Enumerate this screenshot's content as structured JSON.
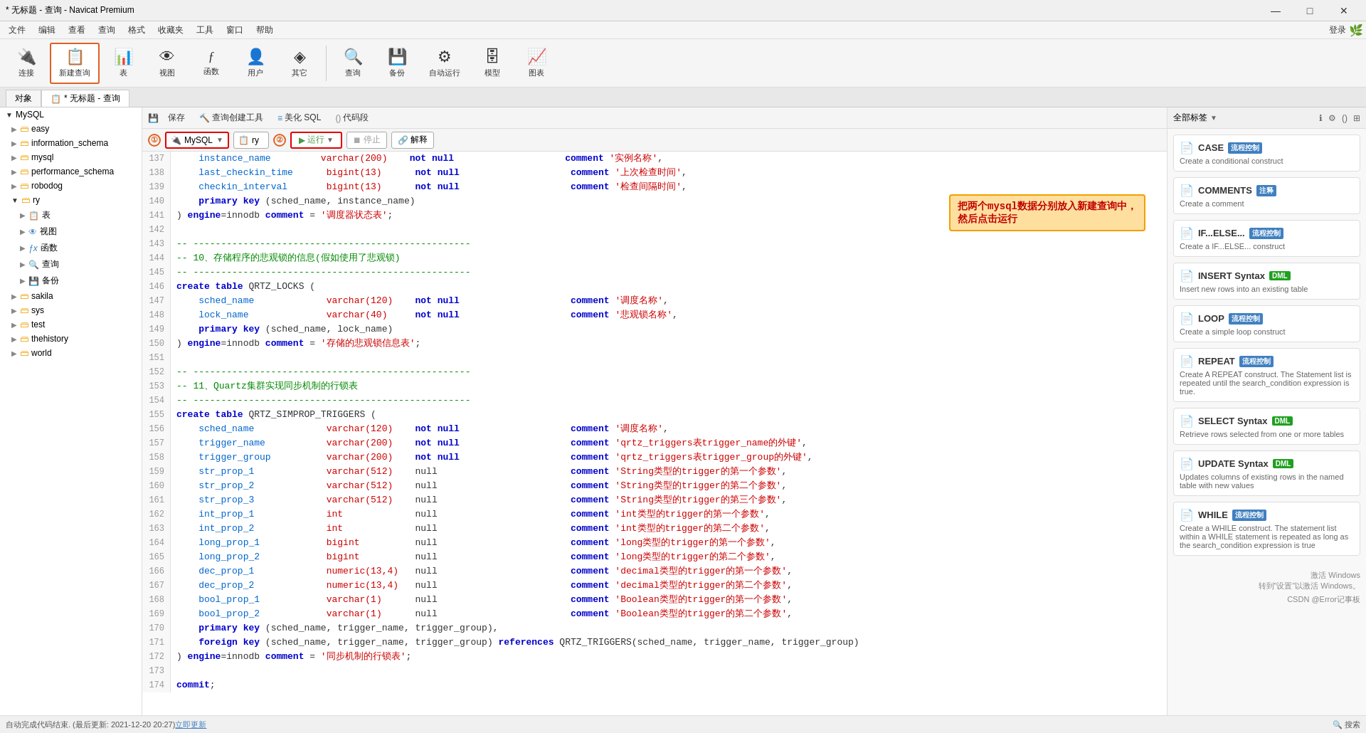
{
  "titlebar": {
    "title": "* 无标题 - 查询 - Navicat Premium",
    "min": "—",
    "max": "□",
    "close": "✕"
  },
  "menubar": {
    "items": [
      "文件",
      "编辑",
      "查看",
      "查询",
      "格式",
      "收藏夹",
      "工具",
      "窗口",
      "帮助"
    ],
    "login": "登录"
  },
  "toolbar": {
    "items": [
      {
        "label": "连接",
        "icon": "🔌"
      },
      {
        "label": "新建查询",
        "icon": "📋",
        "active": true
      },
      {
        "label": "表",
        "icon": "📊"
      },
      {
        "label": "视图",
        "icon": "👁"
      },
      {
        "label": "函数",
        "icon": "ƒ"
      },
      {
        "label": "用户",
        "icon": "👤"
      },
      {
        "label": "其它",
        "icon": "◈"
      },
      {
        "label": "查询",
        "icon": "🔍"
      },
      {
        "label": "备份",
        "icon": "💾"
      },
      {
        "label": "自动运行",
        "icon": "⚙"
      },
      {
        "label": "模型",
        "icon": "🗄"
      },
      {
        "label": "图表",
        "icon": "📈"
      }
    ]
  },
  "tabbar": {
    "object_tab": "对象",
    "query_tab": "* 无标题 - 查询"
  },
  "sidebar": {
    "root": "MySQL",
    "items": [
      {
        "label": "easy",
        "level": 1,
        "type": "db",
        "expanded": false
      },
      {
        "label": "information_schema",
        "level": 1,
        "type": "db"
      },
      {
        "label": "mysql",
        "level": 1,
        "type": "db"
      },
      {
        "label": "performance_schema",
        "level": 1,
        "type": "db"
      },
      {
        "label": "robodog",
        "level": 1,
        "type": "db"
      },
      {
        "label": "ry",
        "level": 1,
        "type": "db",
        "expanded": true
      },
      {
        "label": "表",
        "level": 2,
        "type": "table"
      },
      {
        "label": "视图",
        "level": 2,
        "type": "view"
      },
      {
        "label": "函数",
        "level": 2,
        "type": "fn"
      },
      {
        "label": "查询",
        "level": 2,
        "type": "query"
      },
      {
        "label": "备份",
        "level": 2,
        "type": "backup"
      },
      {
        "label": "sakila",
        "level": 1,
        "type": "db"
      },
      {
        "label": "sys",
        "level": 1,
        "type": "db"
      },
      {
        "label": "test",
        "level": 1,
        "type": "db"
      },
      {
        "label": "thehistory",
        "level": 1,
        "type": "db"
      },
      {
        "label": "world",
        "level": 1,
        "type": "db"
      }
    ]
  },
  "editor_toolbar": {
    "save": "保存",
    "build": "查询创建工具",
    "beautify": "美化 SQL",
    "snippet": "代码段"
  },
  "runbar": {
    "db_placeholder": "MySQL",
    "schema_placeholder": "ry",
    "run": "运行",
    "stop": "停止",
    "explain": "解释",
    "circle1": "①",
    "circle2": "②"
  },
  "code": {
    "lines": [
      {
        "num": 137,
        "content": "    instance_name         varchar(200)    not null                    comment '实例名称',"
      },
      {
        "num": 138,
        "content": "    last_checkin_time      bigint(13)      not null                    comment '上次检查时间',"
      },
      {
        "num": 139,
        "content": "    checkin_interval       bigint(13)      not null                    comment '检查间隔时间',"
      },
      {
        "num": 140,
        "content": "    primary key (sched_name, instance_name)"
      },
      {
        "num": 141,
        "content": ") engine=innodb comment = '调度器状态表';"
      },
      {
        "num": 142,
        "content": ""
      },
      {
        "num": 143,
        "content": "-- --------------------------------------------------"
      },
      {
        "num": 144,
        "content": "-- 10、存储程序的悲观锁的信息(假如使用了悲观锁)"
      },
      {
        "num": 145,
        "content": "-- --------------------------------------------------"
      },
      {
        "num": 146,
        "content": "create table QRTZ_LOCKS ("
      },
      {
        "num": 147,
        "content": "    sched_name             varchar(120)    not null                    comment '调度名称',"
      },
      {
        "num": 148,
        "content": "    lock_name              varchar(40)     not null                    comment '悲观锁名称',"
      },
      {
        "num": 149,
        "content": "    primary key (sched_name, lock_name)"
      },
      {
        "num": 150,
        "content": ") engine=innodb comment = '存储的悲观锁信息表';"
      },
      {
        "num": 151,
        "content": ""
      },
      {
        "num": 152,
        "content": "-- --------------------------------------------------"
      },
      {
        "num": 153,
        "content": "-- 11、Quartz集群实现同步机制的行锁表"
      },
      {
        "num": 154,
        "content": "-- --------------------------------------------------"
      },
      {
        "num": 155,
        "content": "create table QRTZ_SIMPROP_TRIGGERS ("
      },
      {
        "num": 156,
        "content": "    sched_name             varchar(120)    not null                    comment '调度名称',"
      },
      {
        "num": 157,
        "content": "    trigger_name           varchar(200)    not null                    comment 'qrtz_triggers表trigger_name的外键',"
      },
      {
        "num": 158,
        "content": "    trigger_group          varchar(200)    not null                    comment 'qrtz_triggers表trigger_group的外键',"
      },
      {
        "num": 159,
        "content": "    str_prop_1             varchar(512)    null                        comment 'String类型的trigger的第一个参数',"
      },
      {
        "num": 160,
        "content": "    str_prop_2             varchar(512)    null                        comment 'String类型的trigger的第二个参数',"
      },
      {
        "num": 161,
        "content": "    str_prop_3             varchar(512)    null                        comment 'String类型的trigger的第三个参数',"
      },
      {
        "num": 162,
        "content": "    int_prop_1             int             null                        comment 'int类型的trigger的第一个参数',"
      },
      {
        "num": 163,
        "content": "    int_prop_2             int             null                        comment 'int类型的trigger的第二个参数',"
      },
      {
        "num": 164,
        "content": "    long_prop_1            bigint          null                        comment 'long类型的trigger的第一个参数',"
      },
      {
        "num": 165,
        "content": "    long_prop_2            bigint          null                        comment 'long类型的trigger的第二个参数',"
      },
      {
        "num": 166,
        "content": "    dec_prop_1             numeric(13,4)   null                        comment 'decimal类型的trigger的第一个参数',"
      },
      {
        "num": 167,
        "content": "    dec_prop_2             numeric(13,4)   null                        comment 'decimal类型的trigger的第二个参数',"
      },
      {
        "num": 168,
        "content": "    bool_prop_1            varchar(1)      null                        comment 'Boolean类型的trigger的第一个参数',"
      },
      {
        "num": 169,
        "content": "    bool_prop_2            varchar(1)      null                        comment 'Boolean类型的trigger的第二个参数',"
      },
      {
        "num": 170,
        "content": "    primary key (sched_name, trigger_name, trigger_group),"
      },
      {
        "num": 171,
        "content": "    foreign key (sched_name, trigger_name, trigger_group) references QRTZ_TRIGGERS(sched_name, trigger_name, trigger_group)"
      },
      {
        "num": 172,
        "content": ") engine=innodb comment = '同步机制的行锁表';"
      },
      {
        "num": 173,
        "content": ""
      },
      {
        "num": 174,
        "content": "commit;"
      }
    ]
  },
  "annotation": {
    "text": "把两个mysql数据分别放入新建查询中，\n然后点击运行"
  },
  "right_panel": {
    "header": "全部标签",
    "snippets": [
      {
        "title": "CASE",
        "tag": "流程控制",
        "desc": "Create a conditional construct"
      },
      {
        "title": "COMMENTS",
        "tag": "注释",
        "desc": "Create a comment"
      },
      {
        "title": "IF...ELSE...",
        "tag": "流程控制",
        "desc": "Create a IF...ELSE... construct"
      },
      {
        "title": "INSERT Syntax",
        "tag": "DML",
        "desc": "Insert new rows into an existing table"
      },
      {
        "title": "LOOP",
        "tag": "流程控制",
        "desc": "Create a simple loop construct"
      },
      {
        "title": "REPEAT",
        "tag": "流程控制",
        "desc": "Create A REPEAT construct. The Statement list is repeated until the search_condition expression is true."
      },
      {
        "title": "SELECT Syntax",
        "tag": "DML",
        "desc": "Retrieve rows selected from one or more tables"
      },
      {
        "title": "UPDATE Syntax",
        "tag": "DML",
        "desc": "Updates columns of existing rows in the named table with new values"
      },
      {
        "title": "WHILE",
        "tag": "流程控制",
        "desc": "Create a WHILE construct. The statement list within a WHILE statement is repeated as long as the search_condition expression is true"
      }
    ]
  },
  "statusbar": {
    "text": "自动完成代码结束. (最后更新: 2021-12-20 20:27)",
    "update_link": "立即更新",
    "watermark": "激活 Windows\n转到\"设置\"以激活 Windows。",
    "source": "CSDN @Error记事板"
  }
}
